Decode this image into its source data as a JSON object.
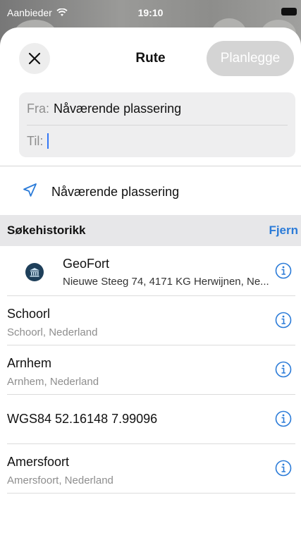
{
  "status_bar": {
    "carrier": "Aanbieder",
    "time": "19:10"
  },
  "header": {
    "title": "Rute",
    "plan_button": "Planlegge"
  },
  "route": {
    "from_label": "Fra:",
    "from_value": "Nåværende plassering",
    "to_label": "Til:",
    "to_value": ""
  },
  "current_location": {
    "label": "Nåværende plassering"
  },
  "history": {
    "title": "Søkehistorikk",
    "clear_label": "Fjern",
    "items": [
      {
        "title": "GeoFort",
        "subtitle": "Nieuwe Steeg 74, 4171 KG Herwijnen, Ne...",
        "icon": "museum-icon"
      },
      {
        "title": "Schoorl",
        "subtitle": "Schoorl, Nederland"
      },
      {
        "title": "Arnhem",
        "subtitle": "Arnhem, Nederland"
      },
      {
        "title": "WGS84 52.16148 7.99096",
        "subtitle": ""
      },
      {
        "title": "Amersfoort",
        "subtitle": "Amersfoort, Nederland"
      }
    ]
  },
  "colors": {
    "accent": "#2b7bd8",
    "plan_button_disabled": "#d4d4d4",
    "museum_icon": "#1e3f5a"
  }
}
